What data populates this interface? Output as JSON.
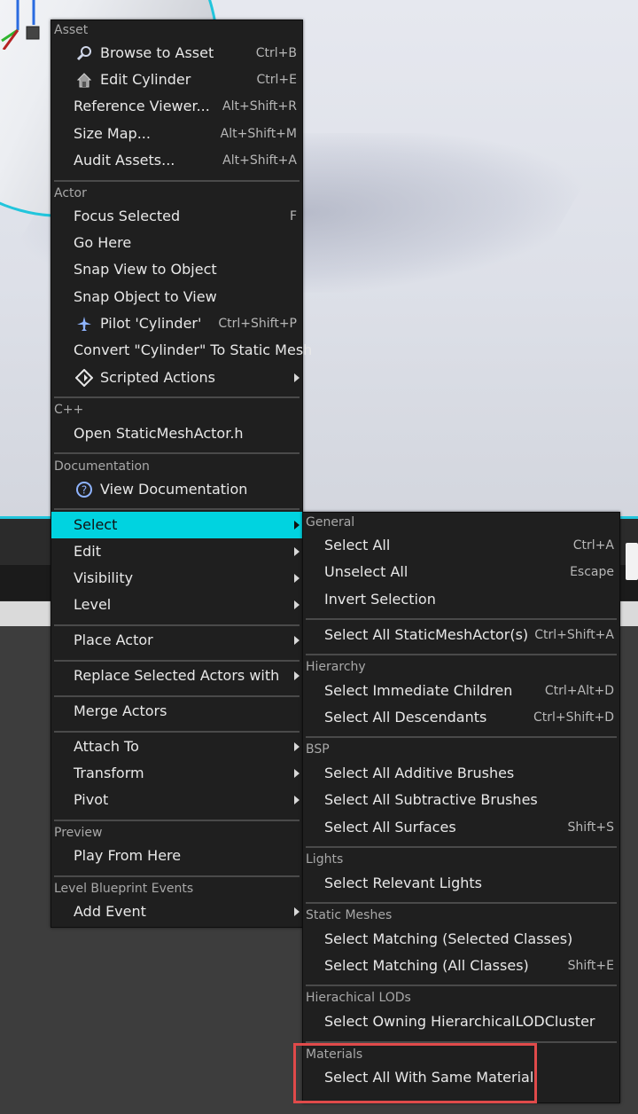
{
  "main_menu": {
    "sections": {
      "asset": "Asset",
      "actor": "Actor",
      "cpp": "C++",
      "documentation": "Documentation",
      "preview": "Preview",
      "level_blueprint": "Level Blueprint Events"
    },
    "items": {
      "browse_to_asset": {
        "label": "Browse to Asset",
        "shortcut": "Ctrl+B",
        "icon": "search-icon"
      },
      "edit_cylinder": {
        "label": "Edit Cylinder",
        "shortcut": "Ctrl+E",
        "icon": "edit-asset-icon"
      },
      "reference_viewer": {
        "label": "Reference Viewer...",
        "shortcut": "Alt+Shift+R"
      },
      "size_map": {
        "label": "Size Map...",
        "shortcut": "Alt+Shift+M"
      },
      "audit_assets": {
        "label": "Audit Assets...",
        "shortcut": "Alt+Shift+A"
      },
      "focus_selected": {
        "label": "Focus Selected",
        "shortcut": "F"
      },
      "go_here": {
        "label": "Go Here"
      },
      "snap_view_to_object": {
        "label": "Snap View to Object"
      },
      "snap_object_to_view": {
        "label": "Snap Object to View"
      },
      "pilot_cylinder": {
        "label": "Pilot 'Cylinder'",
        "shortcut": "Ctrl+Shift+P",
        "icon": "airplane-icon"
      },
      "convert_to_static_mesh": {
        "label": "Convert \"Cylinder\" To Static Mesh"
      },
      "scripted_actions": {
        "label": "Scripted Actions",
        "icon": "diamond-icon"
      },
      "open_header": {
        "label": "Open StaticMeshActor.h"
      },
      "view_documentation": {
        "label": "View Documentation",
        "icon": "help-icon"
      },
      "select": {
        "label": "Select"
      },
      "edit": {
        "label": "Edit"
      },
      "visibility": {
        "label": "Visibility"
      },
      "level": {
        "label": "Level"
      },
      "place_actor": {
        "label": "Place Actor"
      },
      "replace_selected": {
        "label": "Replace Selected Actors with"
      },
      "merge_actors": {
        "label": "Merge Actors"
      },
      "attach_to": {
        "label": "Attach To"
      },
      "transform": {
        "label": "Transform"
      },
      "pivot": {
        "label": "Pivot"
      },
      "play_from_here": {
        "label": "Play From Here"
      },
      "add_event": {
        "label": "Add Event"
      }
    }
  },
  "sub_menu": {
    "sections": {
      "general": "General",
      "hierarchy": "Hierarchy",
      "bsp": "BSP",
      "lights": "Lights",
      "static_meshes": "Static Meshes",
      "hlods": "Hierachical LODs",
      "materials": "Materials"
    },
    "items": {
      "select_all": {
        "label": "Select All",
        "shortcut": "Ctrl+A"
      },
      "unselect_all": {
        "label": "Unselect All",
        "shortcut": "Escape"
      },
      "invert_selection": {
        "label": "Invert Selection"
      },
      "select_all_staticmeshactor": {
        "label": "Select All StaticMeshActor(s)",
        "shortcut": "Ctrl+Shift+A"
      },
      "select_immediate_children": {
        "label": "Select Immediate Children",
        "shortcut": "Ctrl+Alt+D"
      },
      "select_all_descendants": {
        "label": "Select All Descendants",
        "shortcut": "Ctrl+Shift+D"
      },
      "select_additive_brushes": {
        "label": "Select All Additive Brushes"
      },
      "select_subtractive_brushes": {
        "label": "Select All Subtractive Brushes"
      },
      "select_all_surfaces": {
        "label": "Select All Surfaces",
        "shortcut": "Shift+S"
      },
      "select_relevant_lights": {
        "label": "Select Relevant Lights"
      },
      "select_matching_selected": {
        "label": "Select Matching (Selected Classes)"
      },
      "select_matching_all": {
        "label": "Select Matching (All Classes)",
        "shortcut": "Shift+E"
      },
      "select_owning_hlod": {
        "label": "Select Owning HierarchicalLODCluster"
      },
      "select_same_material": {
        "label": "Select All With Same Material"
      }
    }
  },
  "colors": {
    "highlight": "#00d3e0",
    "annotation_box": "#e04a4a",
    "menu_bg": "#1f1f1f"
  }
}
